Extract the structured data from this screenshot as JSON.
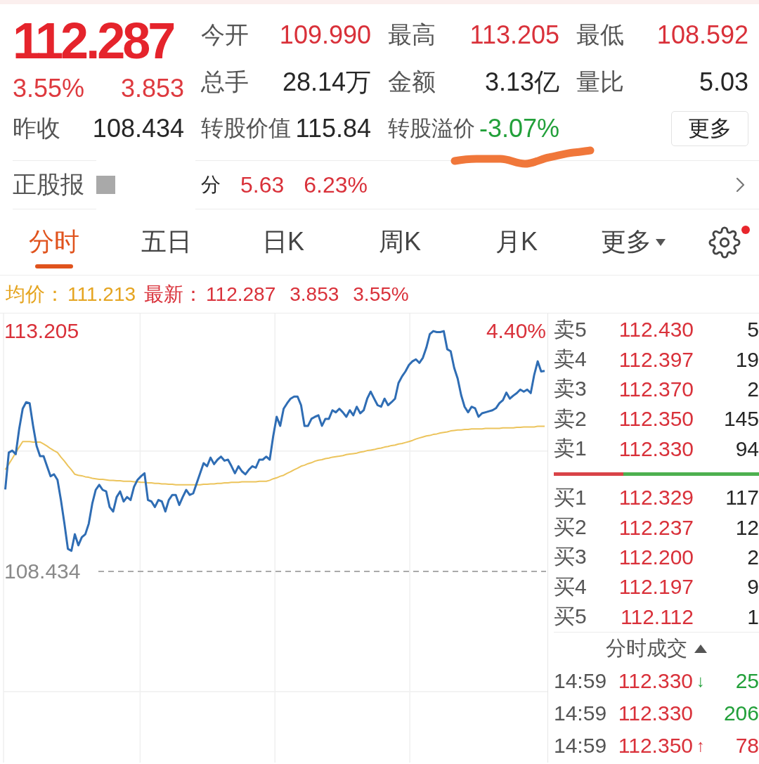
{
  "quote": {
    "price": "112.287",
    "change_pct": "3.55%",
    "change": "3.853",
    "prev_close_label": "昨收",
    "prev_close": "108.434",
    "stats": [
      {
        "label": "今开",
        "value": "109.990",
        "color": "#d9313a",
        "underlined": false
      },
      {
        "label": "最高",
        "value": "113.205",
        "color": "#d9313a",
        "underlined": false
      },
      {
        "label": "最低",
        "value": "108.592",
        "color": "#d9313a",
        "underlined": false
      },
      {
        "label": "总手",
        "value": "28.14万",
        "color": "#262626",
        "underlined": false
      },
      {
        "label": "金额",
        "value": "3.13亿",
        "color": "#262626",
        "underlined": false
      },
      {
        "label": "量比",
        "value": "5.03",
        "color": "#262626",
        "underlined": false
      },
      {
        "label": "转股价值",
        "value": "115.84",
        "color": "#262626",
        "underlined": false
      },
      {
        "label": "转股溢价",
        "value": "-3.07%",
        "color": "#22a03a",
        "underlined": true
      }
    ],
    "more_button": "更多"
  },
  "stock_row": {
    "label": "正股报",
    "redacted": true,
    "partial_text": "分",
    "price": "5.63",
    "change_pct": "6.23%"
  },
  "tabs": [
    {
      "label": "分时",
      "selected": true,
      "kind": "tab"
    },
    {
      "label": "五日",
      "selected": false,
      "kind": "tab"
    },
    {
      "label": "日K",
      "selected": false,
      "kind": "tab"
    },
    {
      "label": "周K",
      "selected": false,
      "kind": "tab"
    },
    {
      "label": "月K",
      "selected": false,
      "kind": "tab"
    },
    {
      "label": "更多",
      "selected": false,
      "kind": "dropdown"
    }
  ],
  "settings": {
    "notification_dot": true
  },
  "chart": {
    "legend": [
      {
        "label": "均价：",
        "values": [
          "111.213"
        ],
        "kind": "average"
      },
      {
        "label": "最新：",
        "values": [
          "112.287",
          "3.853",
          "3.55%"
        ],
        "kind": "latest"
      }
    ],
    "pct_label": "4.40%",
    "chart_data": {
      "type": "line",
      "series": [
        {
          "color": "#ecc45c",
          "values": [
            110.45,
            110.56,
            110.67,
            110.79,
            110.9,
            111.01,
            111.01,
            111.01,
            111.0,
            111.0,
            111.0,
            110.96,
            110.92,
            110.87,
            110.83,
            110.79,
            110.7,
            110.62,
            110.53,
            110.45,
            110.36,
            110.34,
            110.33,
            110.31,
            110.3,
            110.28,
            110.27,
            110.26,
            110.26,
            110.25,
            110.24,
            110.24,
            110.23,
            110.23,
            110.22,
            110.22,
            110.22,
            110.21,
            110.21,
            110.2,
            110.2,
            110.19,
            110.19,
            110.18,
            110.18,
            110.17,
            110.17,
            110.16,
            110.16,
            110.15,
            110.15,
            110.15,
            110.15,
            110.15,
            110.15,
            110.15,
            110.15,
            110.16,
            110.16,
            110.17,
            110.17,
            110.18,
            110.18,
            110.19,
            110.19,
            110.2,
            110.2,
            110.2,
            110.21,
            110.21,
            110.21,
            110.21,
            110.21,
            110.22,
            110.22,
            110.22,
            110.24,
            110.27,
            110.29,
            110.32,
            110.34,
            110.38,
            110.41,
            110.45,
            110.48,
            110.52,
            110.54,
            110.57,
            110.59,
            110.62,
            110.64,
            110.65,
            110.67,
            110.68,
            110.7,
            110.71,
            110.72,
            110.73,
            110.75,
            110.76,
            110.77,
            110.78,
            110.8,
            110.81,
            110.83,
            110.84,
            110.85,
            110.87,
            110.88,
            110.9,
            110.91,
            110.93,
            110.94,
            110.96,
            110.97,
            110.99,
            111.01,
            111.03,
            111.06,
            111.08,
            111.1,
            111.12,
            111.13,
            111.15,
            111.16,
            111.18,
            111.19,
            111.2,
            111.22,
            111.23,
            111.24,
            111.24,
            111.25,
            111.25,
            111.26,
            111.26,
            111.26,
            111.26,
            111.27,
            111.27,
            111.27,
            111.27,
            111.27,
            111.28,
            111.28,
            111.28,
            111.28,
            111.29,
            111.29,
            111.3,
            111.3,
            111.3,
            111.3,
            111.31,
            111.31,
            111.31
          ]
        },
        {
          "color": "#2f6db4",
          "values": [
            110.06,
            110.79,
            110.83,
            110.76,
            111.26,
            111.66,
            111.79,
            111.77,
            111.32,
            110.92,
            110.72,
            110.72,
            110.52,
            110.32,
            110.36,
            110.25,
            109.85,
            109.38,
            108.88,
            108.84,
            109.17,
            108.95,
            109.11,
            109.17,
            109.38,
            109.78,
            110.05,
            110.15,
            110.05,
            110.02,
            109.71,
            109.62,
            109.91,
            110.02,
            109.82,
            109.91,
            109.85,
            110.11,
            110.25,
            110.32,
            110.38,
            109.85,
            109.82,
            109.71,
            109.85,
            109.82,
            109.62,
            109.85,
            109.95,
            109.95,
            109.75,
            109.91,
            110.05,
            109.95,
            109.98,
            110.18,
            110.38,
            110.58,
            110.52,
            110.69,
            110.56,
            110.65,
            110.71,
            110.63,
            110.65,
            110.52,
            110.38,
            110.52,
            110.42,
            110.36,
            110.45,
            110.52,
            110.49,
            110.65,
            110.65,
            110.71,
            110.65,
            111.12,
            111.5,
            111.32,
            111.66,
            111.77,
            111.86,
            111.9,
            111.9,
            111.73,
            111.32,
            111.32,
            111.46,
            111.5,
            111.53,
            111.32,
            111.46,
            111.46,
            111.63,
            111.59,
            111.66,
            111.59,
            111.5,
            111.63,
            111.53,
            111.7,
            111.57,
            111.63,
            111.86,
            112.0,
            111.86,
            111.73,
            111.7,
            111.86,
            111.73,
            111.79,
            111.86,
            112.17,
            112.3,
            112.4,
            112.53,
            112.6,
            112.64,
            112.57,
            112.67,
            112.87,
            113.14,
            113.2,
            113.18,
            113.18,
            113.2,
            112.84,
            112.8,
            112.47,
            112.26,
            111.93,
            111.7,
            111.59,
            111.7,
            111.67,
            111.5,
            111.57,
            111.59,
            111.61,
            111.63,
            111.67,
            111.77,
            111.83,
            111.98,
            111.86,
            111.92,
            111.97,
            112.04,
            112.0,
            112.04,
            111.97,
            112.33,
            112.6,
            112.4,
            112.41
          ]
        }
      ],
      "ylim": [
        104.64,
        113.55
      ],
      "yticks": [
        {
          "value": 113.205,
          "label": "113.205"
        },
        {
          "value": 108.434,
          "label": "108.434"
        }
      ],
      "ref_lines": [
        {
          "axis": "y",
          "value": 108.434
        }
      ]
    }
  },
  "order_book": {
    "asks": [
      {
        "label": "卖5",
        "price": "112.430",
        "volume": "5"
      },
      {
        "label": "卖4",
        "price": "112.397",
        "volume": "19"
      },
      {
        "label": "卖3",
        "price": "112.370",
        "volume": "2"
      },
      {
        "label": "卖2",
        "price": "112.350",
        "volume": "145"
      },
      {
        "label": "卖1",
        "price": "112.330",
        "volume": "94"
      }
    ],
    "ratio": {
      "level": 0.34
    },
    "bids": [
      {
        "label": "买1",
        "price": "112.329",
        "volume": "117"
      },
      {
        "label": "买2",
        "price": "112.237",
        "volume": "12"
      },
      {
        "label": "买3",
        "price": "112.200",
        "volume": "2"
      },
      {
        "label": "买4",
        "price": "112.197",
        "volume": "9"
      },
      {
        "label": "买5",
        "price": "112.112",
        "volume": "1"
      }
    ]
  },
  "trades": {
    "title": "分时成交",
    "rows": [
      {
        "time": "14:59",
        "price": "112.330",
        "arrow": "↓",
        "color": "#22a03a",
        "volume": "25"
      },
      {
        "time": "14:59",
        "price": "112.330",
        "color": "#22a03a",
        "volume": "206"
      },
      {
        "time": "14:59",
        "price": "112.350",
        "arrow": "↑",
        "color": "#d9313a",
        "volume": "78"
      }
    ]
  }
}
